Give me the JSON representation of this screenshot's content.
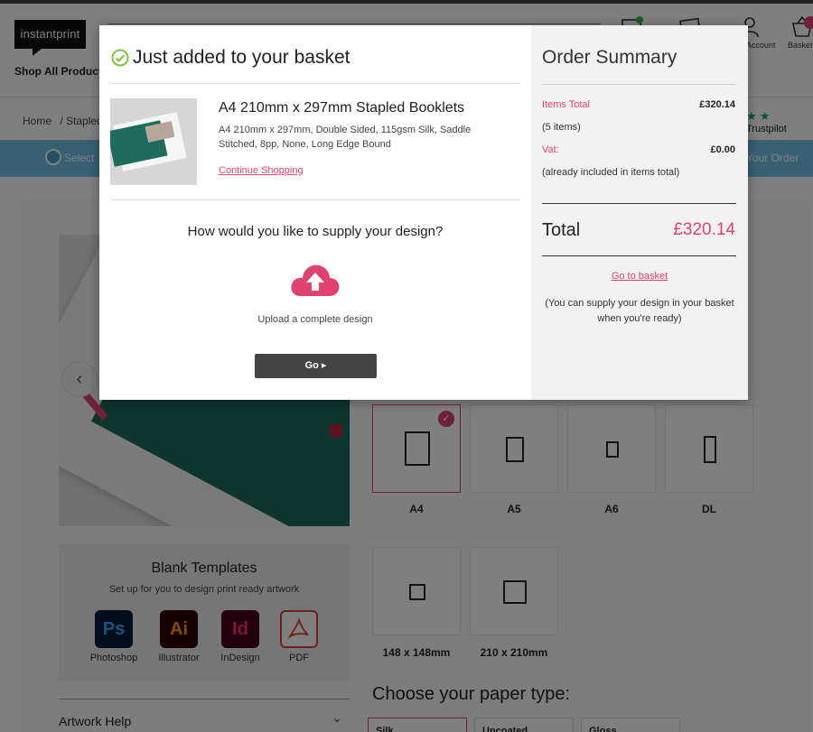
{
  "header": {
    "logo": "instantprint",
    "shop_all": "Shop All Products",
    "account_label": "Account",
    "basket_label": "Basket"
  },
  "breadcrumb": {
    "home": "Home",
    "current": "/ Stapled Booklets"
  },
  "trustpilot": "Trustpilot",
  "steps": {
    "first": "Select",
    "last": "Your Order"
  },
  "templates": {
    "title": "Blank Templates",
    "subtitle": "Set up for you to design print ready artwork",
    "apps": [
      {
        "name": "Photoshop",
        "abbr": "Ps",
        "color": "#31a8ff",
        "bg": "#001e36"
      },
      {
        "name": "Illustrator",
        "abbr": "Ai",
        "color": "#ff9a00",
        "bg": "#330000"
      },
      {
        "name": "InDesign",
        "abbr": "Id",
        "color": "#ff3366",
        "bg": "#49021f"
      },
      {
        "name": "PDF",
        "abbr": "pdf-icon",
        "color": "#e03c31",
        "bg": "#ffffff"
      }
    ]
  },
  "artwork_help": "Artwork Help",
  "sizes": [
    {
      "label": "A4",
      "selected": true
    },
    {
      "label": "A5",
      "selected": false
    },
    {
      "label": "A6",
      "selected": false
    },
    {
      "label": "DL",
      "selected": false
    },
    {
      "label": "148 x 148mm",
      "selected": false
    },
    {
      "label": "210 x 210mm",
      "selected": false
    }
  ],
  "paper": {
    "heading": "Choose your paper type:",
    "options": [
      "Silk",
      "Uncoated",
      "Gloss"
    ]
  },
  "modal": {
    "title": "Just added to your basket",
    "item": {
      "name": "A4 210mm x 297mm Stapled Booklets",
      "description": "A4 210mm x 297mm, Double Sided, 115gsm Silk, Saddle Stitched, 8pp, None, Long Edge Bound",
      "continue": "Continue Shopping"
    },
    "supply_question": "How would you like to supply your design?",
    "upload_label": "Upload a complete design",
    "go_button": "Go",
    "summary": {
      "title": "Order Summary",
      "items_total_label": "Items Total",
      "items_total_value": "£320.14",
      "items_count": "(5 items)",
      "vat_label": "Vat:",
      "vat_value": "£0.00",
      "vat_note": "(already included in items total)",
      "total_label": "Total",
      "total_value": "£320.14",
      "go_basket": "Go to basket",
      "supply_note": "(You can supply your design in your basket when you're ready)"
    },
    "accent_color": "#e0426f"
  }
}
